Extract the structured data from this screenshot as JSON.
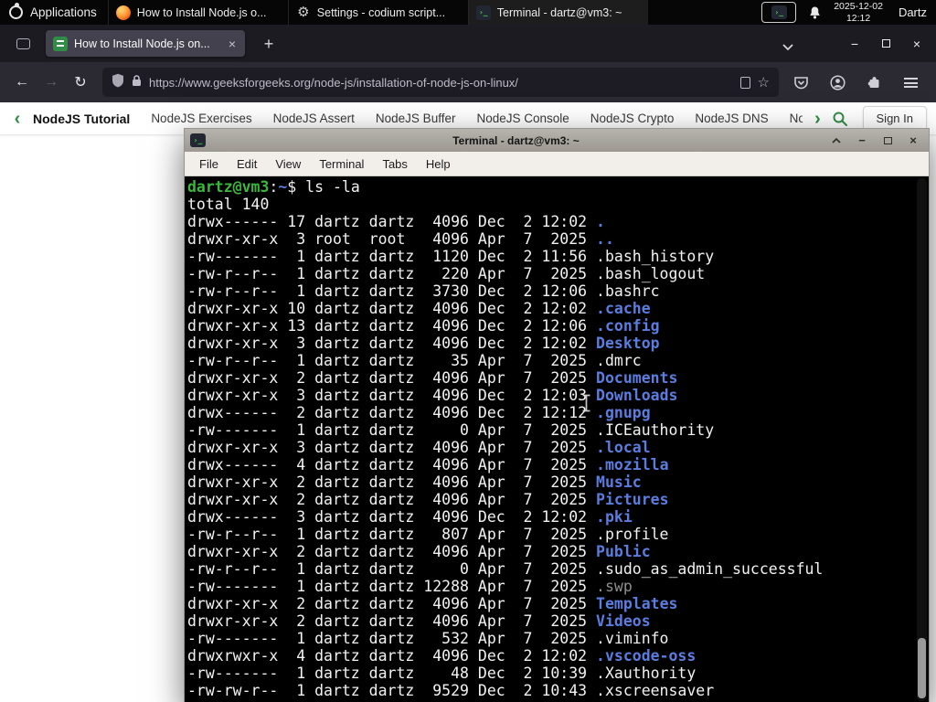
{
  "icons": {
    "close": "×",
    "plus": "+",
    "back": "←",
    "forward": "→",
    "reload": "↻",
    "star": "☆",
    "chevron_left": "‹",
    "chevron_right": "›",
    "minimize": "−",
    "gear": "⚙",
    "terminal_glyph": "›_"
  },
  "panel": {
    "applications": "Applications",
    "taskbar": [
      {
        "icon": "firefox",
        "label": "How to Install Node.js o...",
        "active": false
      },
      {
        "icon": "settings",
        "label": "Settings - codium script...",
        "active": false
      },
      {
        "icon": "terminal",
        "label": "Terminal - dartz@vm3: ~",
        "active": true
      }
    ],
    "clock": {
      "date": "2025-12-02",
      "time": "12:12"
    },
    "user": "Dartz"
  },
  "browser": {
    "tab_title": "How to Install Node.js on...",
    "url": "https://www.geeksforgeeks.org/node-js/installation-of-node-js-on-linux/"
  },
  "site_nav": {
    "items": [
      {
        "label": "NodeJS Tutorial",
        "bold": true
      },
      {
        "label": "NodeJS Exercises"
      },
      {
        "label": "NodeJS Assert"
      },
      {
        "label": "NodeJS Buffer"
      },
      {
        "label": "NodeJS Console"
      },
      {
        "label": "NodeJS Crypto"
      },
      {
        "label": "NodeJS DNS"
      },
      {
        "label": "Node"
      }
    ],
    "sign_in": "Sign In"
  },
  "terminal": {
    "title": "Terminal - dartz@vm3: ~",
    "menus": [
      "File",
      "Edit",
      "View",
      "Terminal",
      "Tabs",
      "Help"
    ],
    "lines": [
      [
        {
          "t": "dartz@vm3",
          "c": "g"
        },
        {
          "t": ":",
          "c": "w"
        },
        {
          "t": "~",
          "c": "b"
        },
        {
          "t": "$ ls -la",
          "c": "w"
        }
      ],
      [
        {
          "t": "total 140",
          "c": "w"
        }
      ],
      [
        {
          "t": "drwx------ 17 dartz dartz  4096 Dec  2 12:02 ",
          "c": "w"
        },
        {
          "t": ".",
          "c": "b"
        }
      ],
      [
        {
          "t": "drwxr-xr-x  3 root  root   4096 Apr  7  2025 ",
          "c": "w"
        },
        {
          "t": "..",
          "c": "b"
        }
      ],
      [
        {
          "t": "-rw-------  1 dartz dartz  1120 Dec  2 11:56 .bash_history",
          "c": "w"
        }
      ],
      [
        {
          "t": "-rw-r--r--  1 dartz dartz   220 Apr  7  2025 .bash_logout",
          "c": "w"
        }
      ],
      [
        {
          "t": "-rw-r--r--  1 dartz dartz  3730 Dec  2 12:06 .bashrc",
          "c": "w"
        }
      ],
      [
        {
          "t": "drwxr-xr-x 10 dartz dartz  4096 Dec  2 12:02 ",
          "c": "w"
        },
        {
          "t": ".cache",
          "c": "b"
        }
      ],
      [
        {
          "t": "drwxr-xr-x 13 dartz dartz  4096 Dec  2 12:06 ",
          "c": "w"
        },
        {
          "t": ".config",
          "c": "b"
        }
      ],
      [
        {
          "t": "drwxr-xr-x  3 dartz dartz  4096 Dec  2 12:02 ",
          "c": "w"
        },
        {
          "t": "Desktop",
          "c": "b"
        }
      ],
      [
        {
          "t": "-rw-r--r--  1 dartz dartz    35 Apr  7  2025 .dmrc",
          "c": "w"
        }
      ],
      [
        {
          "t": "drwxr-xr-x  2 dartz dartz  4096 Apr  7  2025 ",
          "c": "w"
        },
        {
          "t": "Documents",
          "c": "b"
        }
      ],
      [
        {
          "t": "drwxr-xr-x  3 dartz dartz  4096 Dec  2 12:03 ",
          "c": "w"
        },
        {
          "t": "Downloads",
          "c": "b"
        }
      ],
      [
        {
          "t": "drwx------  2 dartz dartz  4096 Dec  2 12:12 ",
          "c": "w"
        },
        {
          "t": ".gnupg",
          "c": "b"
        }
      ],
      [
        {
          "t": "-rw-------  1 dartz dartz     0 Apr  7  2025 .ICEauthority",
          "c": "w"
        }
      ],
      [
        {
          "t": "drwxr-xr-x  3 dartz dartz  4096 Apr  7  2025 ",
          "c": "w"
        },
        {
          "t": ".local",
          "c": "b"
        }
      ],
      [
        {
          "t": "drwx------  4 dartz dartz  4096 Apr  7  2025 ",
          "c": "w"
        },
        {
          "t": ".mozilla",
          "c": "b"
        }
      ],
      [
        {
          "t": "drwxr-xr-x  2 dartz dartz  4096 Apr  7  2025 ",
          "c": "w"
        },
        {
          "t": "Music",
          "c": "b"
        }
      ],
      [
        {
          "t": "drwxr-xr-x  2 dartz dartz  4096 Apr  7  2025 ",
          "c": "w"
        },
        {
          "t": "Pictures",
          "c": "b"
        }
      ],
      [
        {
          "t": "drwx------  3 dartz dartz  4096 Dec  2 12:02 ",
          "c": "w"
        },
        {
          "t": ".pki",
          "c": "b"
        }
      ],
      [
        {
          "t": "-rw-r--r--  1 dartz dartz   807 Apr  7  2025 .profile",
          "c": "w"
        }
      ],
      [
        {
          "t": "drwxr-xr-x  2 dartz dartz  4096 Apr  7  2025 ",
          "c": "w"
        },
        {
          "t": "Public",
          "c": "b"
        }
      ],
      [
        {
          "t": "-rw-r--r--  1 dartz dartz     0 Apr  7  2025 .sudo_as_admin_successful",
          "c": "w"
        }
      ],
      [
        {
          "t": "-rw-------  1 dartz dartz 12288 Apr  7  2025 ",
          "c": "w"
        },
        {
          "t": ".swp",
          "c": "d"
        }
      ],
      [
        {
          "t": "drwxr-xr-x  2 dartz dartz  4096 Apr  7  2025 ",
          "c": "w"
        },
        {
          "t": "Templates",
          "c": "b"
        }
      ],
      [
        {
          "t": "drwxr-xr-x  2 dartz dartz  4096 Apr  7  2025 ",
          "c": "w"
        },
        {
          "t": "Videos",
          "c": "b"
        }
      ],
      [
        {
          "t": "-rw-------  1 dartz dartz   532 Apr  7  2025 .viminfo",
          "c": "w"
        }
      ],
      [
        {
          "t": "drwxrwxr-x  4 dartz dartz  4096 Dec  2 12:02 ",
          "c": "w"
        },
        {
          "t": ".vscode-oss",
          "c": "b"
        }
      ],
      [
        {
          "t": "-rw-------  1 dartz dartz    48 Dec  2 10:39 .Xauthority",
          "c": "w"
        }
      ],
      [
        {
          "t": "-rw-rw-r--  1 dartz dartz  9529 Dec  2 10:43 .xscreensaver",
          "c": "w"
        }
      ]
    ]
  }
}
